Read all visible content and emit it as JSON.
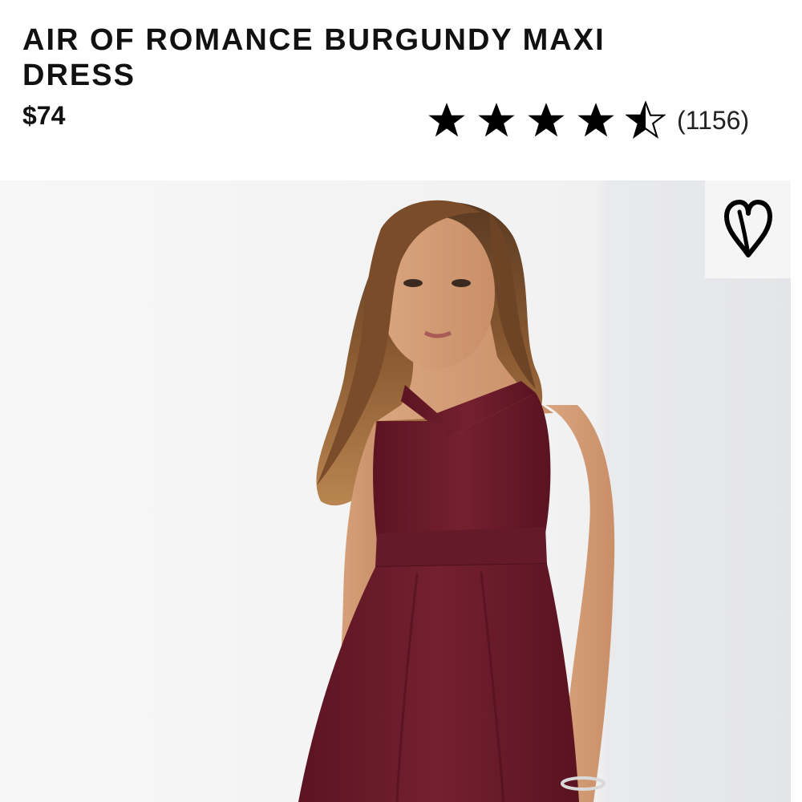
{
  "product": {
    "title": "AIR OF ROMANCE BURGUNDY MAXI DRESS",
    "price": "$74",
    "rating": {
      "stars": 4.5,
      "max": 5,
      "review_count": "(1156)"
    }
  },
  "image": {
    "subject": "model-wearing-burgundy-halter-maxi-dress",
    "dress_color": "#6e1a2a"
  },
  "icons": {
    "wishlist": "heart-icon",
    "rating": "star-icon"
  }
}
